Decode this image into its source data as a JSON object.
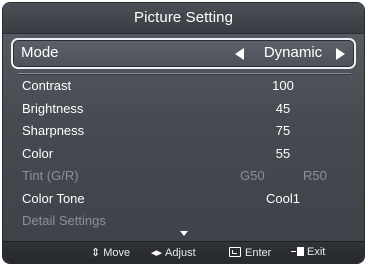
{
  "title": "Picture Setting",
  "mode": {
    "label": "Mode",
    "value": "Dynamic"
  },
  "settings": [
    {
      "label": "Contrast",
      "value": "100",
      "enabled": true
    },
    {
      "label": "Brightness",
      "value": "45",
      "enabled": true
    },
    {
      "label": "Sharpness",
      "value": "75",
      "enabled": true
    },
    {
      "label": "Color",
      "value": "55",
      "enabled": true
    },
    {
      "label": "Tint (G/R)",
      "value_g": "G50",
      "value_r": "R50",
      "enabled": false
    },
    {
      "label": "Color Tone",
      "value": "Cool1",
      "enabled": true
    },
    {
      "label": "Detail Settings",
      "value": "",
      "enabled": false
    }
  ],
  "footer": {
    "move": "Move",
    "adjust": "Adjust",
    "enter": "Enter",
    "exit": "Exit"
  },
  "icons": [
    "move-updown-icon",
    "adjust-leftright-icon",
    "enter-icon",
    "exit-icon",
    "scroll-down-icon"
  ]
}
